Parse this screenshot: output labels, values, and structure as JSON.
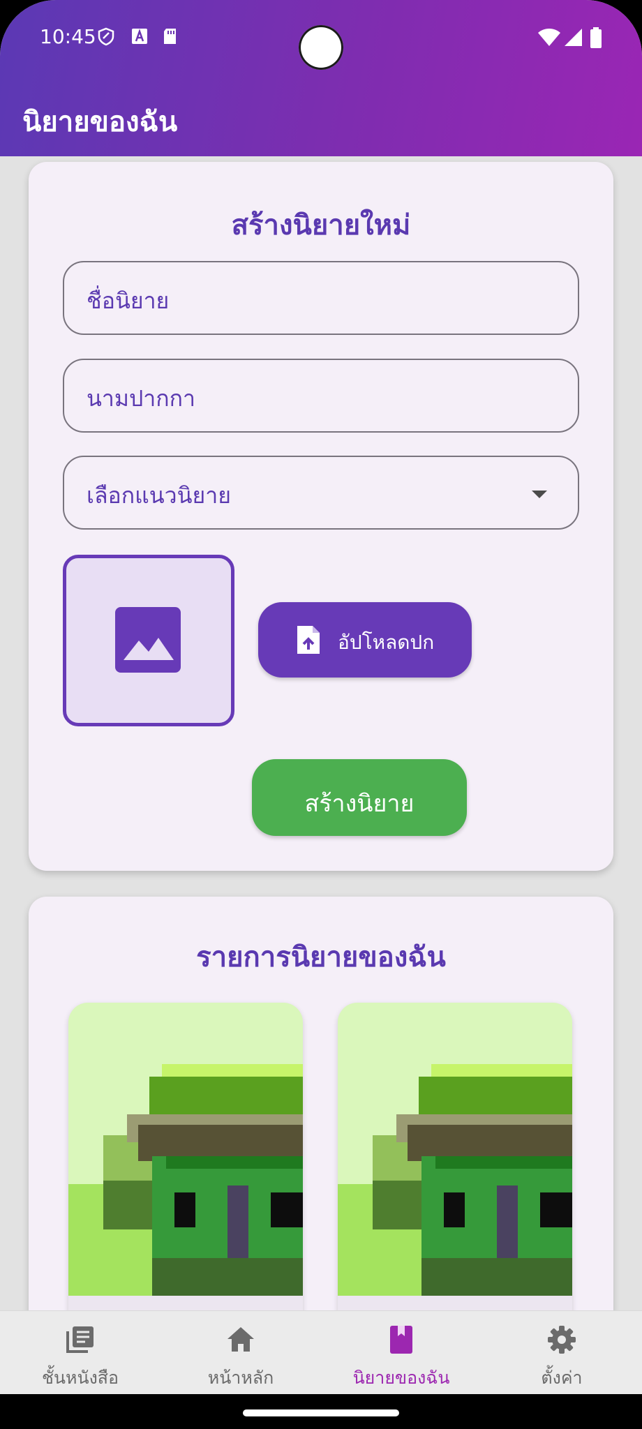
{
  "status_bar": {
    "time": "10:45"
  },
  "app_bar": {
    "title": "นิยายของฉัน"
  },
  "create_card": {
    "title": "สร้างนิยายใหม่",
    "title_field_placeholder": "ชื่อนิยาย",
    "pen_name_placeholder": "นามปากกา",
    "genre_select_placeholder": "เลือกแนวนิยาย",
    "upload_cover_label": "อัปโหลดปก",
    "create_button_label": "สร้างนิยาย"
  },
  "list_card": {
    "title": "รายการนิยายของฉัน"
  },
  "bottom_nav": {
    "items": [
      {
        "label": "ชั้นหนังสือ",
        "icon": "library-books-icon"
      },
      {
        "label": "หน้าหลัก",
        "icon": "home-icon"
      },
      {
        "label": "นิยายของฉัน",
        "icon": "book-icon",
        "active": true
      },
      {
        "label": "ตั้งค่า",
        "icon": "settings-gear-icon"
      }
    ]
  },
  "colors": {
    "primary": "#673ab7",
    "accent_active": "#9c27b0",
    "create_button": "#4caf50",
    "card_bg": "#f5eff8"
  }
}
